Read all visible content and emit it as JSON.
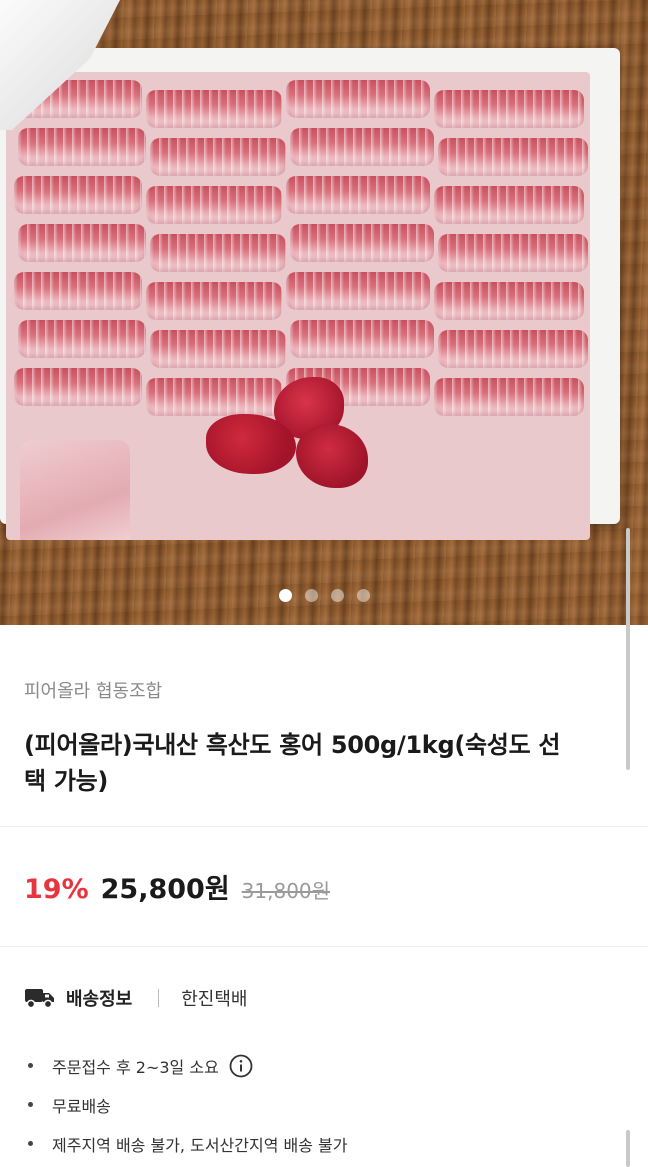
{
  "hero": {
    "image_subject": "skate sashimi slices in styrofoam box",
    "carousel_pages": 4,
    "carousel_active_index": 0
  },
  "product": {
    "seller": "피어올라 협동조합",
    "title": "(피어올라)국내산 흑산도 홍어 500g/1kg(숙성도 선택 가능)"
  },
  "pricing": {
    "discount": "19%",
    "price": "25,800원",
    "original_price": "31,800원"
  },
  "shipping": {
    "label": "배송정보",
    "carrier": "한진택배",
    "items": [
      "주문접수 후 2~3일 소요",
      "무료배송",
      "제주지역 배송 불가, 도서산간지역 배송 불가"
    ]
  },
  "colors": {
    "discount": "#e8343f",
    "text": "#1a1a1a",
    "muted": "#8a8a8a"
  },
  "icons": [
    "truck-icon",
    "info-icon"
  ]
}
